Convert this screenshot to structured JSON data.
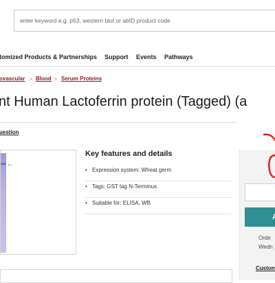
{
  "search": {
    "placeholder": "enter keyword e.g. p53, western blot or abID product code"
  },
  "nav": {
    "items": [
      "tomized Products & Partnerships",
      "Support",
      "Events",
      "Pathways"
    ]
  },
  "breadcrumb": {
    "items": [
      "ovascular",
      "Blood",
      "Serum Proteins"
    ],
    "separator": ">"
  },
  "product": {
    "title": "nt Human Lactoferrin protein (Tagged) (a",
    "question_link": "uestion"
  },
  "features": {
    "heading": "Key features and details",
    "items": [
      "Expression system: Wheat germ",
      "Tags: GST tag N-Terminus",
      "Suitable for: ELISA, WB"
    ]
  },
  "purchase": {
    "add_label": "A",
    "order_text": "Orde",
    "day_text": "Wedn",
    "link_text": "Custom"
  },
  "colors": {
    "accent": "#2f8f93",
    "breadcrumb": "#8a1c1c",
    "annotation": "#e02020"
  }
}
